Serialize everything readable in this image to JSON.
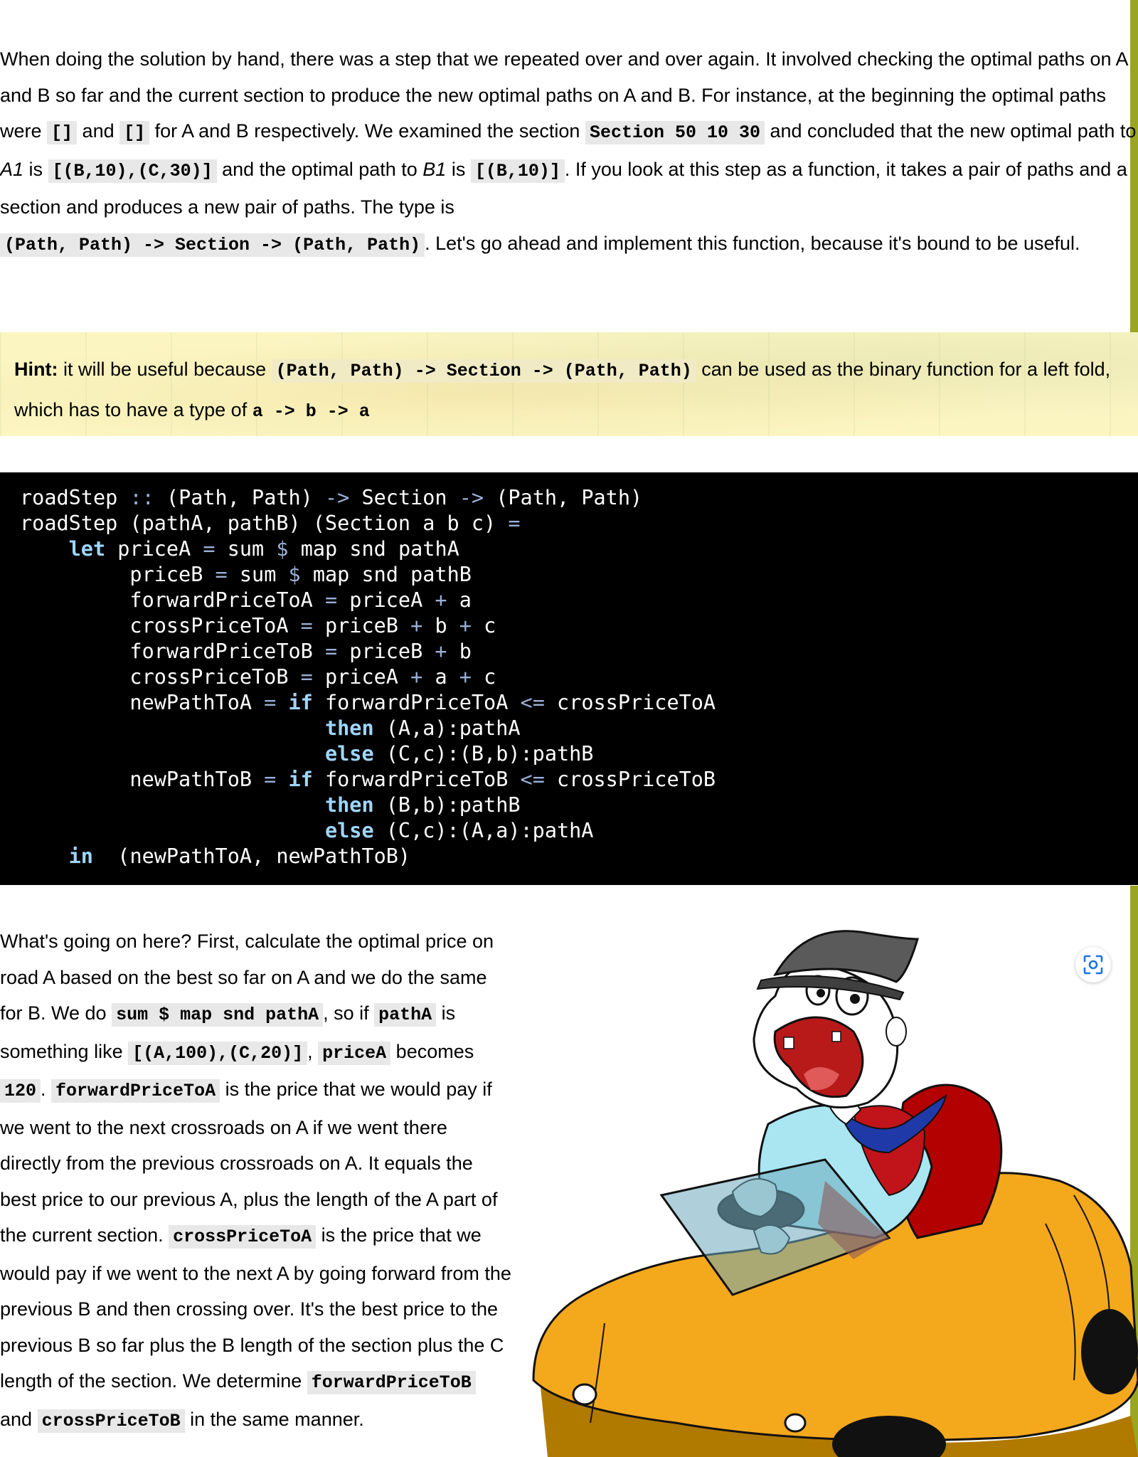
{
  "intro": {
    "t1": "When doing the solution by hand, there was a step that we repeated over and over again. It involved checking the optimal paths on A and B so far and the current section to produce the new optimal paths on A and B. For instance, at the beginning the optimal paths were ",
    "c1": "[]",
    "t2": " and ",
    "c2": "[]",
    "t3": " for A and B respectively. We examined the section ",
    "c3": "Section 50 10 30",
    "t4": " and concluded that the new optimal path to ",
    "e1": "A1",
    "t5": " is ",
    "c4": "[(B,10),(C,30)]",
    "t6": " and the optimal path to ",
    "e2": "B1",
    "t7": " is ",
    "c5": "[(B,10)]",
    "t8": ". If you look at this step as a function, it takes a pair of paths and a section and produces a new pair of paths. The type is",
    "c6": "(Path, Path) -> Section -> (Path, Path)",
    "t9": ". Let's go ahead and implement this function, because it's bound to be useful."
  },
  "hint": {
    "label": "Hint:",
    "t1": " it will be useful because ",
    "c1": "(Path, Path) -> Section -> (Path, Path)",
    "t2": " can be used as the binary function for a left fold, which has to have a type of ",
    "c2": "a -> b -> a"
  },
  "code": {
    "kw_let": "let",
    "kw_if": "if",
    "kw_then": "then",
    "kw_else": "else",
    "kw_in": "in",
    "dcolon": "::",
    "arrow": "->",
    "eq": "=",
    "dollar": "$",
    "plus": "+",
    "le": "<=",
    "l1_a": "roadStep ",
    "l1_b": " (Path, Path) ",
    "l1_c": " Section ",
    "l1_d": " (Path, Path)",
    "l2": "roadStep (pathA, pathB) (Section a b c) ",
    "l3_a": " priceA ",
    "l3_b": " sum ",
    "l3_c": " map snd pathA",
    "l4_a": "         priceB ",
    "l4_b": " sum ",
    "l4_c": " map snd pathB",
    "l5_a": "         forwardPriceToA ",
    "l5_b": " priceA ",
    "l5_c": " a",
    "l6_a": "         crossPriceToA ",
    "l6_b": " priceB ",
    "l6_c": " b ",
    "l6_d": " c",
    "l7_a": "         forwardPriceToB ",
    "l7_b": " priceB ",
    "l7_c": " b",
    "l8_a": "         crossPriceToB ",
    "l8_b": " priceA ",
    "l8_c": " a ",
    "l8_d": " c",
    "l9_a": "         newPathToA ",
    "l9_b": " forwardPriceToA ",
    "l9_c": " crossPriceToA",
    "l10": " (A,a):pathA",
    "l11": " (C,c):(B,b):pathB",
    "l12_a": "         newPathToB ",
    "l12_b": " forwardPriceToB ",
    "l12_c": " crossPriceToB",
    "l13": " (B,b):pathB",
    "l14": " (C,c):(A,a):pathA",
    "l15": "  (newPathToA, newPathToB)"
  },
  "explain": {
    "t1": "What's going on here? First, calculate the optimal price on road A based on the best so far on A and we do the same for B. We do ",
    "c1": "sum $ map snd pathA",
    "t2": ", so if ",
    "c2": "pathA",
    "t3": " is something like ",
    "c3": "[(A,100),(C,20)]",
    "t4": ", ",
    "c4": "priceA",
    "t5": " becomes ",
    "c5": "120",
    "t6": ". ",
    "c6": "forwardPriceToA",
    "t7": " is the price that we would pay if we went to the next crossroads on A if we went there directly from the previous crossroads on A. It equals the best price to our previous A, plus the length of the A part of the current section. ",
    "c7": "crossPriceToA",
    "t8": " is the price that we would pay if we went to the next A by going forward from the previous B and then crossing over. It's the best price to the previous B so far plus the B length of the section plus the C length of the section. We determine ",
    "c8": "forwardPriceToB",
    "t9": " and ",
    "c9": "crossPriceToB",
    "t10": " in the same manner."
  },
  "icons": {
    "scan": "image-search-icon",
    "illustration": "cartoon-driver-in-car"
  },
  "colors": {
    "accent": "#9aa61f",
    "hint_bg": "#fbf5c2",
    "code_bg": "#000000",
    "keyword": "#9fd6ff",
    "inline_code_bg": "#e8e8e8"
  }
}
